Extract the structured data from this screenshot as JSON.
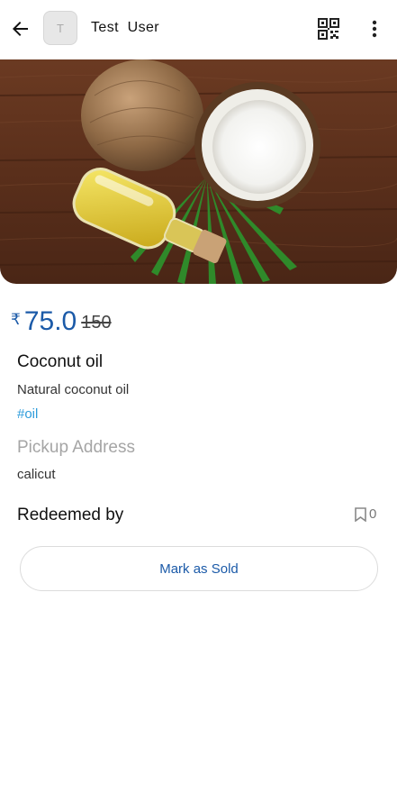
{
  "header": {
    "avatar_initial": "T",
    "user_name": "Test  User",
    "icons": [
      "back-arrow-icon",
      "qr-code-icon",
      "more-vert-icon"
    ]
  },
  "product": {
    "image": "coconut-oil-photo",
    "currency_symbol": "₹",
    "price": "75.0",
    "original_price": "150",
    "title": "Coconut oil",
    "description": "Natural coconut oil",
    "tag": "#oil",
    "pickup_label": "Pickup Address",
    "pickup_address": "calicut"
  },
  "redeemed": {
    "label": "Redeemed by",
    "count": "0",
    "icon": "bookmark-icon"
  },
  "actions": {
    "mark_sold_label": "Mark as Sold"
  },
  "colors": {
    "price": "#1b5aa8",
    "tag": "#2d9cdb",
    "button_text": "#1b5aa8"
  }
}
